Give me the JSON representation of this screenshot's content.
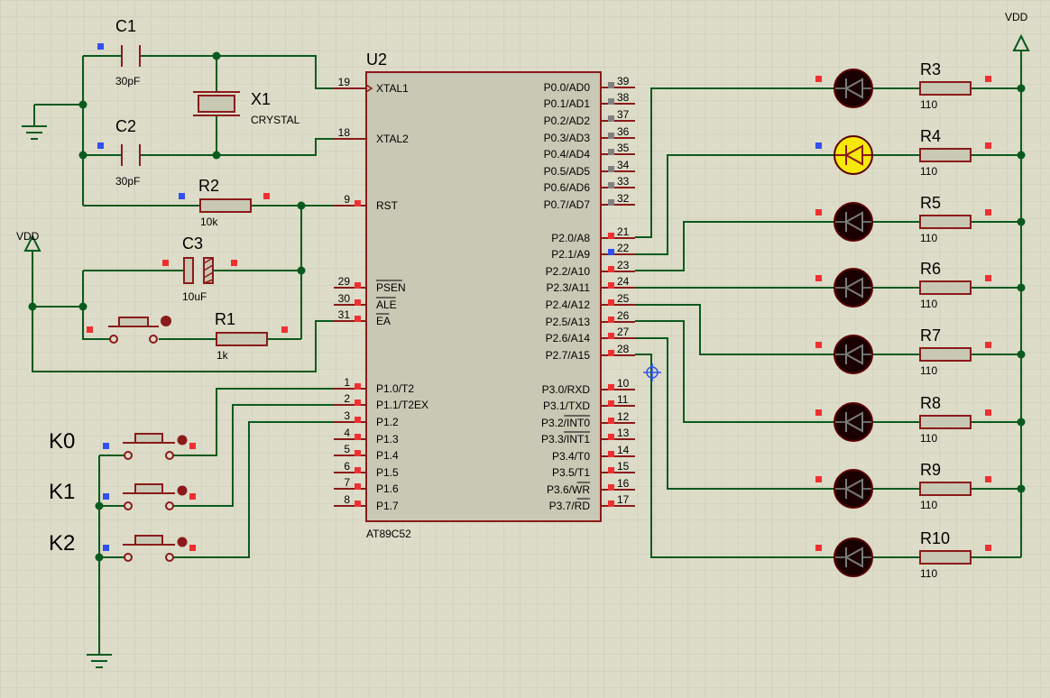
{
  "colors": {
    "background": "#dcdcc8",
    "grid": "#c9c9b4",
    "wire": "#0a5a1e",
    "body_outline": "#8b1a1a",
    "chip_fill": "#c8c8b4",
    "led_off": "#1a0000",
    "led_on": "#f5e80a",
    "pin_high": "#f03030",
    "pin_low": "#3050f0",
    "pin_float": "#808080"
  },
  "chip": {
    "ref": "U2",
    "part": "AT89C52",
    "left_pins": [
      {
        "num": "19",
        "label": "XTAL1"
      },
      {
        "num": "18",
        "label": "XTAL2"
      },
      {
        "num": "9",
        "label": "RST"
      },
      {
        "num": "29",
        "label": "PSEN"
      },
      {
        "num": "30",
        "label": "ALE"
      },
      {
        "num": "31",
        "label": "EA"
      },
      {
        "num": "1",
        "label": "P1.0/T2"
      },
      {
        "num": "2",
        "label": "P1.1/T2EX"
      },
      {
        "num": "3",
        "label": "P1.2"
      },
      {
        "num": "4",
        "label": "P1.3"
      },
      {
        "num": "5",
        "label": "P1.4"
      },
      {
        "num": "6",
        "label": "P1.5"
      },
      {
        "num": "7",
        "label": "P1.6"
      },
      {
        "num": "8",
        "label": "P1.7"
      }
    ],
    "right_pins": [
      {
        "num": "39",
        "label": "P0.0/AD0"
      },
      {
        "num": "38",
        "label": "P0.1/AD1"
      },
      {
        "num": "37",
        "label": "P0.2/AD2"
      },
      {
        "num": "36",
        "label": "P0.3/AD3"
      },
      {
        "num": "35",
        "label": "P0.4/AD4"
      },
      {
        "num": "34",
        "label": "P0.5/AD5"
      },
      {
        "num": "33",
        "label": "P0.6/AD6"
      },
      {
        "num": "32",
        "label": "P0.7/AD7"
      },
      {
        "num": "21",
        "label": "P2.0/A8"
      },
      {
        "num": "22",
        "label": "P2.1/A9"
      },
      {
        "num": "23",
        "label": "P2.2/A10"
      },
      {
        "num": "24",
        "label": "P2.3/A11"
      },
      {
        "num": "25",
        "label": "P2.4/A12"
      },
      {
        "num": "26",
        "label": "P2.5/A13"
      },
      {
        "num": "27",
        "label": "P2.6/A14"
      },
      {
        "num": "28",
        "label": "P2.7/A15"
      },
      {
        "num": "10",
        "label": "P3.0/RXD"
      },
      {
        "num": "11",
        "label": "P3.1/TXD"
      },
      {
        "num": "12",
        "label": "P3.2/INT0"
      },
      {
        "num": "13",
        "label": "P3.3/INT1"
      },
      {
        "num": "14",
        "label": "P3.4/T0"
      },
      {
        "num": "15",
        "label": "P3.5/T1"
      },
      {
        "num": "16",
        "label": "P3.6/WR"
      },
      {
        "num": "17",
        "label": "P3.7/RD"
      }
    ]
  },
  "components": {
    "c1": {
      "ref": "C1",
      "value": "30pF"
    },
    "c2": {
      "ref": "C2",
      "value": "30pF"
    },
    "x1": {
      "ref": "X1",
      "value": "CRYSTAL"
    },
    "r2": {
      "ref": "R2",
      "value": "10k"
    },
    "c3": {
      "ref": "C3",
      "value": "10uF"
    },
    "r1": {
      "ref": "R1",
      "value": "1k"
    }
  },
  "power": {
    "vdd_left": "VDD",
    "vdd_right": "VDD"
  },
  "keys": [
    {
      "ref": "K0"
    },
    {
      "ref": "K1"
    },
    {
      "ref": "K2"
    }
  ],
  "leds": [
    {
      "res_ref": "R3",
      "res_value": "110",
      "lit": false
    },
    {
      "res_ref": "R4",
      "res_value": "110",
      "lit": true
    },
    {
      "res_ref": "R5",
      "res_value": "110",
      "lit": false
    },
    {
      "res_ref": "R6",
      "res_value": "110",
      "lit": false
    },
    {
      "res_ref": "R7",
      "res_value": "110",
      "lit": false
    },
    {
      "res_ref": "R8",
      "res_value": "110",
      "lit": false
    },
    {
      "res_ref": "R9",
      "res_value": "110",
      "lit": false
    },
    {
      "res_ref": "R10",
      "res_value": "110",
      "lit": false
    }
  ]
}
